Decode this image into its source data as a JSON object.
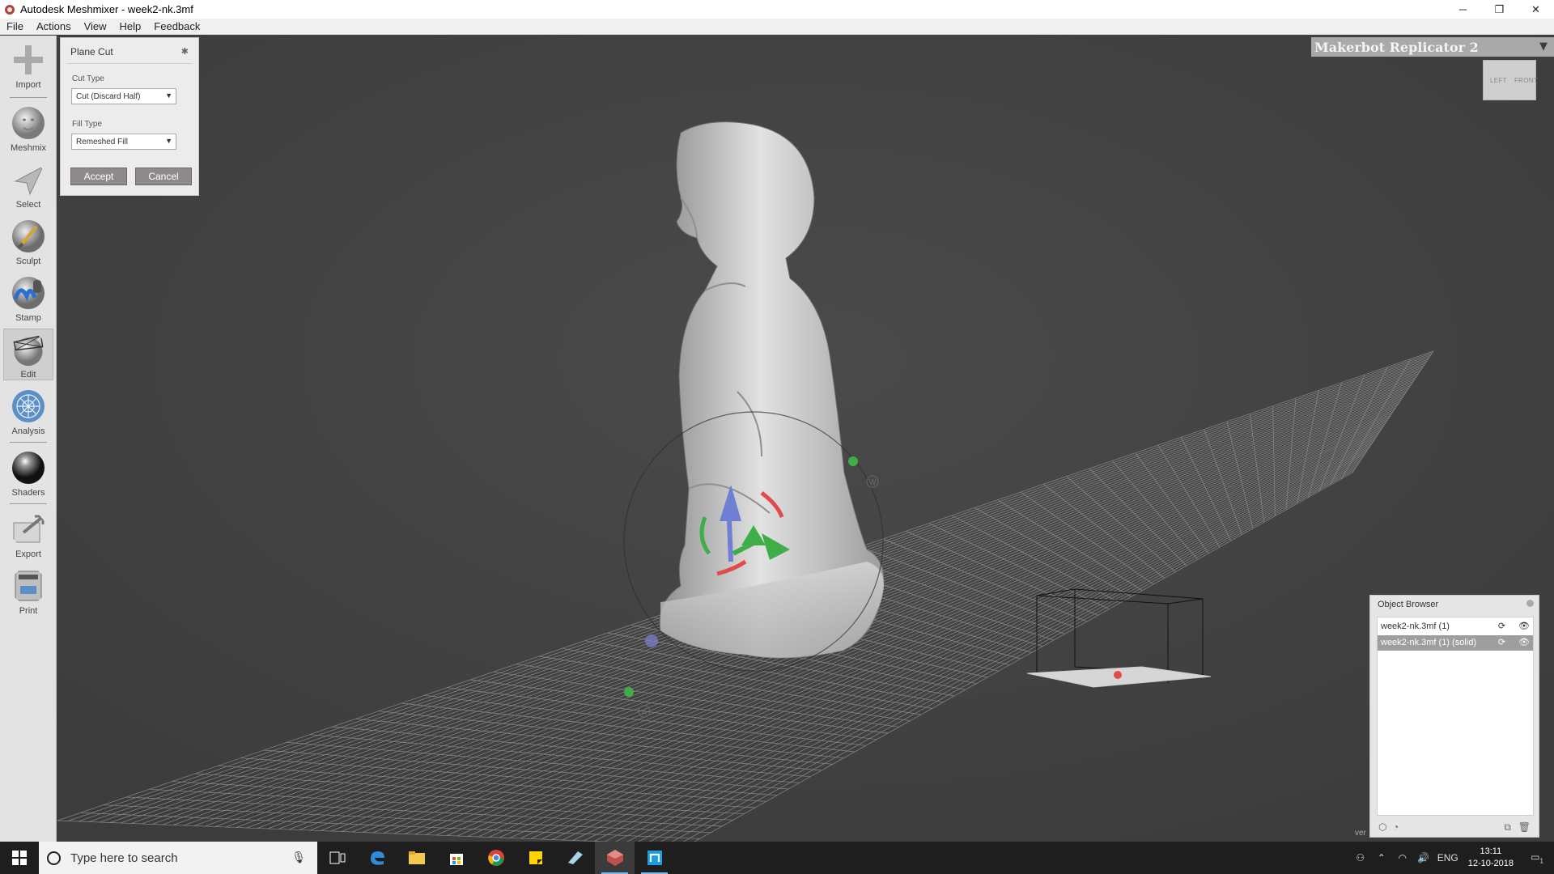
{
  "window": {
    "title": "Autodesk Meshmixer - week2-nk.3mf",
    "minimize": "─",
    "restore": "❐",
    "close": "✕"
  },
  "menu": [
    "File",
    "Actions",
    "View",
    "Help",
    "Feedback"
  ],
  "toolbar": {
    "tools": [
      {
        "label": "Import",
        "icon": "import-icon"
      },
      {
        "label": "Meshmix",
        "icon": "meshmix-icon"
      },
      {
        "label": "Select",
        "icon": "select-icon"
      },
      {
        "label": "Sculpt",
        "icon": "sculpt-icon"
      },
      {
        "label": "Stamp",
        "icon": "stamp-icon"
      },
      {
        "label": "Edit",
        "icon": "edit-icon",
        "active": true
      },
      {
        "label": "Analysis",
        "icon": "analysis-icon"
      },
      {
        "label": "Shaders",
        "icon": "shaders-icon"
      },
      {
        "label": "Export",
        "icon": "export-icon"
      },
      {
        "label": "Print",
        "icon": "print-icon"
      }
    ]
  },
  "plane_cut": {
    "title": "Plane Cut",
    "cut_type_label": "Cut Type",
    "cut_type_value": "Cut (Discard Half)",
    "fill_type_label": "Fill Type",
    "fill_type_value": "Remeshed Fill",
    "accept": "Accept",
    "cancel": "Cancel"
  },
  "printer": {
    "name": "Makerbot Replicator 2",
    "arrow": "▼"
  },
  "viewcube": {
    "left": "LEFT",
    "front": "FRONT"
  },
  "gizmo_labels": {
    "w": "W",
    "a": "A"
  },
  "object_browser": {
    "title": "Object Browser",
    "items": [
      {
        "name": "week2-nk.3mf (1)",
        "selected": false
      },
      {
        "name": "week2-nk.3mf (1) (solid)",
        "selected": true
      }
    ],
    "status_fragment": "ver"
  },
  "taskbar": {
    "search_placeholder": "Type here to search",
    "language": "ENG",
    "time": "13:11",
    "date": "12-10-2018",
    "notification_count": "1"
  },
  "colors": {
    "viewport_bg": "#404040",
    "toolbar_bg": "#e3e3e3",
    "accent_red": "#e14b4b",
    "accent_green": "#3fae49",
    "accent_blue": "#6f7fd4"
  }
}
